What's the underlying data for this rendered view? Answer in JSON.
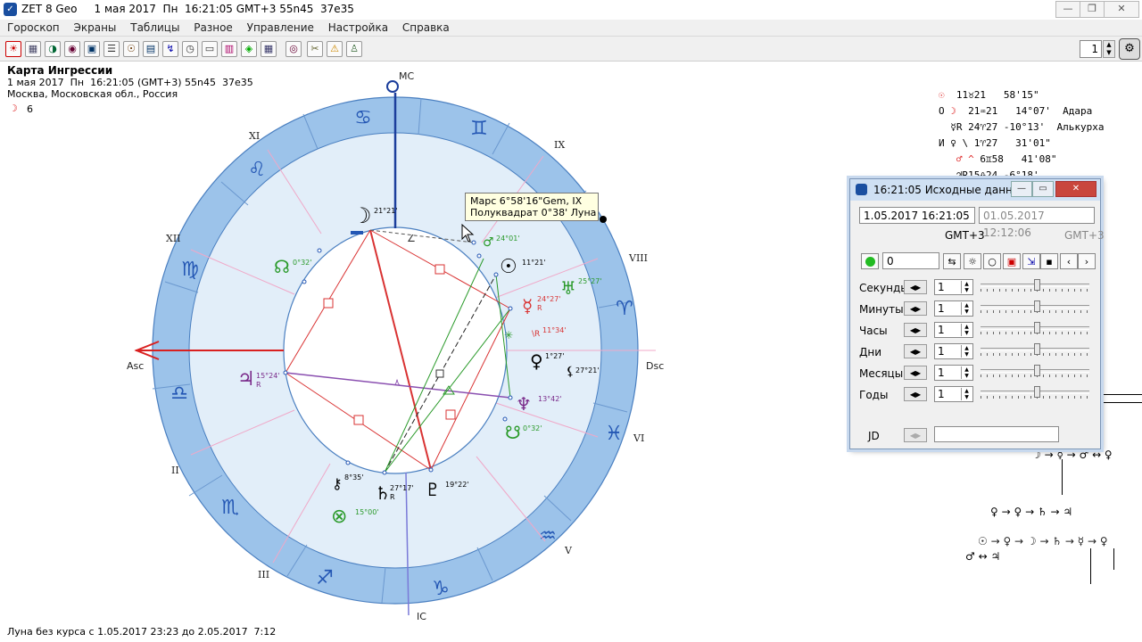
{
  "window": {
    "title": "ZET 8 Geo     1 мая 2017  Пн  16:21:05 GMT+3 55n45  37e35",
    "minimize_glyph": "—",
    "restore_glyph": "❐",
    "close_glyph": "✕"
  },
  "menu": [
    "Гороскоп",
    "Экраны",
    "Таблицы",
    "Разное",
    "Управление",
    "Настройка",
    "Справка"
  ],
  "toolbar": {
    "page_number": "1"
  },
  "info": {
    "chart_title": "Карта Ингрессии",
    "datetime": "1 мая 2017  Пн  16:21:05 (GMT+3) 55n45  37e35",
    "place": "Москва, Московская обл., Россия",
    "moon_line_glyph": "☽",
    "moon_line_value": "6"
  },
  "chart": {
    "angle_labels": {
      "mc": "MC",
      "ic": "IC",
      "asc": "Asc",
      "dsc": "Dsc"
    },
    "house_labels": [
      "XI",
      "IX",
      "XII",
      "VIII",
      "II",
      "VI",
      "III",
      "V"
    ],
    "signs": [
      "♋",
      "♊",
      "♌",
      "♉",
      "♍",
      "♈",
      "♎",
      "♓",
      "♏",
      "♒",
      "♐",
      "♑"
    ],
    "planets": [
      {
        "glyph": "☽",
        "pos": "21°21'"
      },
      {
        "glyph": "☉",
        "pos": "11°21'"
      },
      {
        "glyph": "♅",
        "pos": "25°27'"
      },
      {
        "glyph": "☿",
        "pos": "24°27'"
      },
      {
        "glyph": "☊",
        "pos": "0°32'"
      },
      {
        "glyph": "♃",
        "pos": "15°24'"
      },
      {
        "glyph": "♀",
        "pos": "1°27'"
      },
      {
        "glyph": "⚸",
        "pos": "27°21'"
      },
      {
        "glyph": "♆",
        "pos": "13°42'"
      },
      {
        "glyph": "☋",
        "pos": "0°32'"
      },
      {
        "glyph": "♄",
        "pos": "27°17'"
      },
      {
        "glyph": "♇",
        "pos": "19°22'"
      },
      {
        "glyph": "⚷",
        "pos": "8°35'"
      },
      {
        "glyph": "⊗",
        "pos": "15°00'"
      },
      {
        "glyph": "♂",
        "pos": "24°01'"
      }
    ],
    "retro": "R",
    "aspect_text": "11°34'"
  },
  "tooltip": {
    "line1": "Марс 6°58'16\"Gem, IX",
    "line2": "Полуквадрат 0°38' Луна"
  },
  "planet_table": [
    {
      "prefix": "",
      "glyph": "☉",
      "sign": "11♉21",
      "deg": " 58'15\"",
      "star": ""
    },
    {
      "prefix": "О",
      "glyph": "☽",
      "sign": "21♒21",
      "deg": " 14°07'",
      "star": "Адара"
    },
    {
      "prefix": "",
      "glyph": "☿R",
      "sign": "24♈27",
      "deg": "-10°13'",
      "star": "Алькурха"
    },
    {
      "prefix": "И",
      "glyph": "♀ \\",
      "sign": "1♈27",
      "deg": " 31'01\"",
      "star": ""
    },
    {
      "prefix": "",
      "glyph": "♂ ^",
      "sign": "6♊58",
      "deg": " 41'08\"",
      "star": ""
    },
    {
      "prefix": "",
      "glyph": "♃R",
      "sign": "15♎24",
      "deg": " -6°18'",
      "star": ""
    }
  ],
  "dialog": {
    "title": "16:21:05 Исходные данные",
    "datetime_field": "1.05.2017   16:21:05",
    "datetime_field2": "01.05.2017   12:12:06",
    "gmt": "GMT+3",
    "gmt2": "GMT+3",
    "counter": "0",
    "rows": [
      {
        "label": "Секунды",
        "value": "1"
      },
      {
        "label": "Минуты",
        "value": "1"
      },
      {
        "label": "Часы",
        "value": "1"
      },
      {
        "label": "Дни",
        "value": "1"
      },
      {
        "label": "Месяцы",
        "value": "1"
      },
      {
        "label": "Годы",
        "value": "1"
      }
    ],
    "jd_label": "JD",
    "jd_value": ""
  },
  "right_panel_chains": {
    "line1": "☽ → ☿ → ♂ ↔ ♀",
    "line2": "♀ → ♀ → ♄ → ♃",
    "line3": "☉ → ♀ → ☽ → ♄ → ☿ → ♀",
    "line4": "♂ ↔ ♃"
  },
  "status": "Луна без курса с 1.05.2017 23:23 до 2.05.2017  7:12",
  "colors": {
    "zodiac_ring": "#9cc3ea",
    "inner_fill": "#e2eef9",
    "accent_blue": "#2457b4",
    "aspect_red": "#d93333",
    "aspect_green": "#2a9a2a",
    "aspect_purple": "#8a4fb0"
  }
}
